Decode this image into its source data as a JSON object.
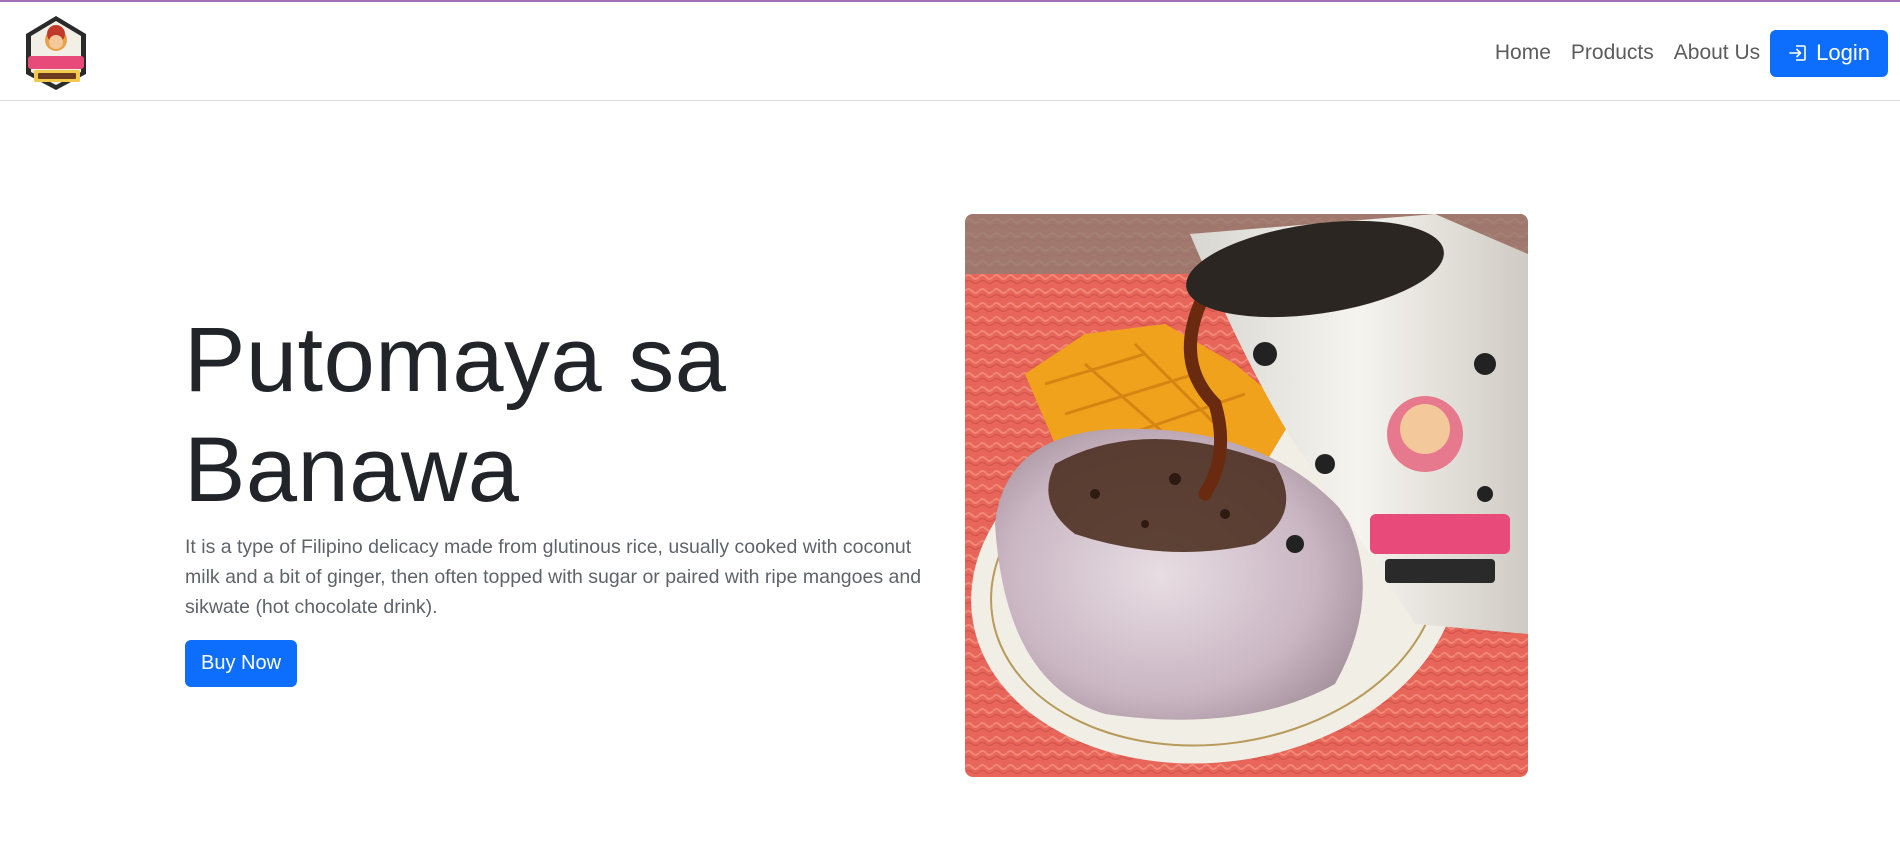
{
  "brand": {
    "logo_name": "Puto sa Banawa logo"
  },
  "nav": {
    "items": [
      {
        "label": "Home"
      },
      {
        "label": "Products"
      },
      {
        "label": "About Us"
      }
    ],
    "login_label": "Login",
    "login_icon": "sign-in-icon"
  },
  "hero": {
    "title": "Putomaya sa Banawa",
    "description": "It is a type of Filipino delicacy made from glutinous rice, usually cooked with coconut milk and a bit of ginger, then often topped with sugar or paired with ripe mangoes and sikwate (hot chocolate drink).",
    "buy_label": "Buy Now",
    "image_name": "putomaya with mango and sikwate"
  },
  "colors": {
    "primary": "#0d6efd",
    "topline": "#a070b8"
  }
}
